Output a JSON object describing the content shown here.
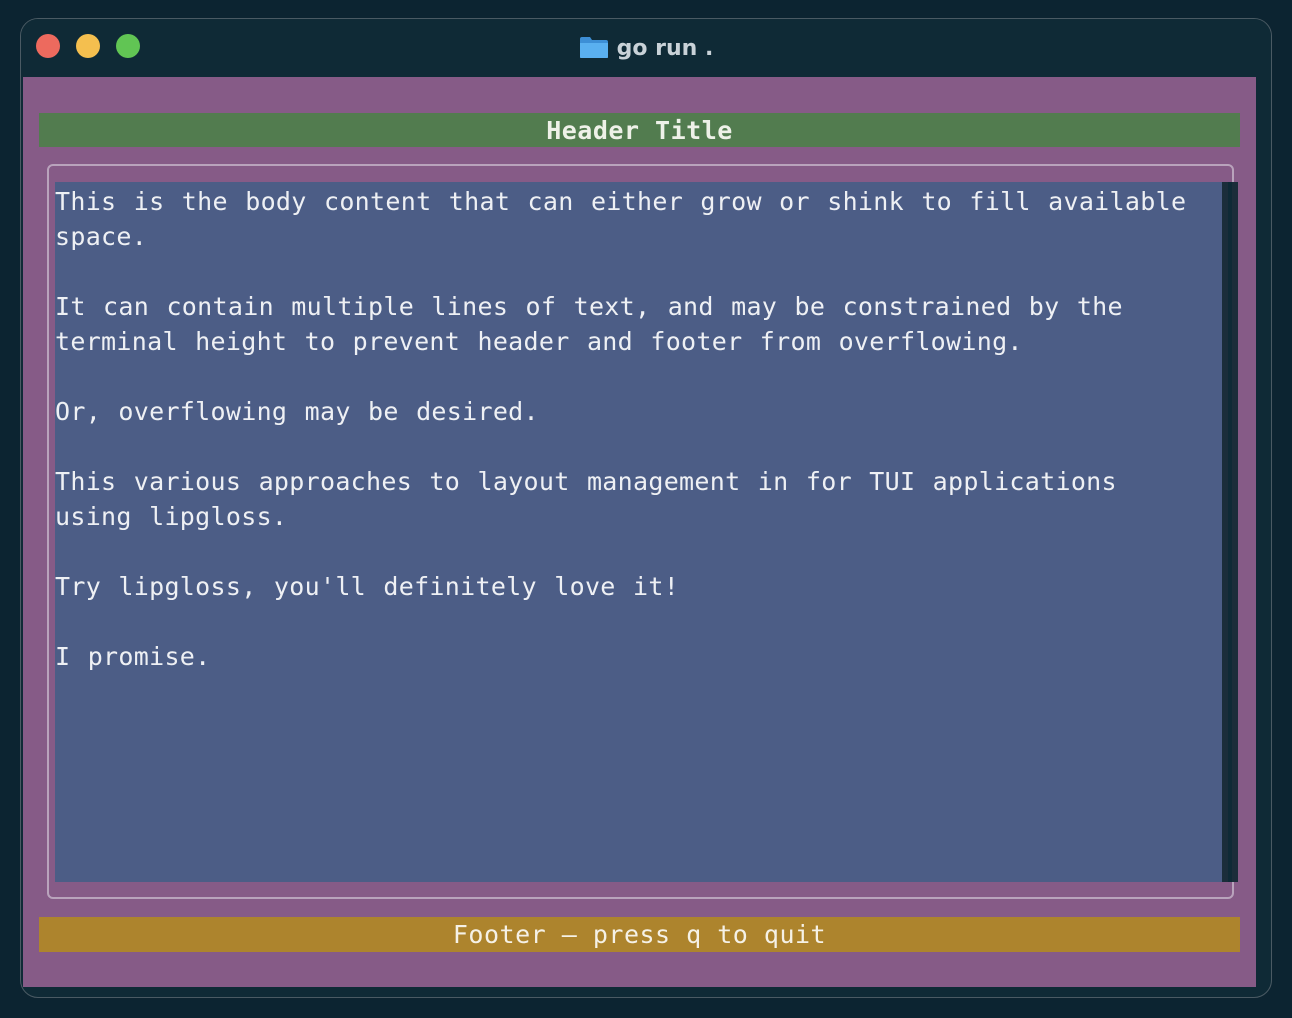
{
  "window": {
    "title": "go run .",
    "folder_icon": "folder-icon"
  },
  "header": {
    "title": "Header Title"
  },
  "body": {
    "paragraphs": [
      "This is the body content that can either grow or shink to fill available\nspace.",
      "It can contain multiple lines of text, and may be constrained by the\nterminal height to prevent header and footer from overflowing.",
      "Or, overflowing may be desired.",
      "This various approaches to layout management in for TUI applications\nusing lipgloss.",
      "Try lipgloss, you'll definitely love it!",
      "I promise."
    ]
  },
  "footer": {
    "text": "Footer — press q to quit"
  },
  "colors": {
    "terminal_bg": "#865b87",
    "header_bg": "#527c4f",
    "body_bg": "#4c5d86",
    "footer_bg": "#ad842d",
    "window_bg": "#0f2a36"
  }
}
